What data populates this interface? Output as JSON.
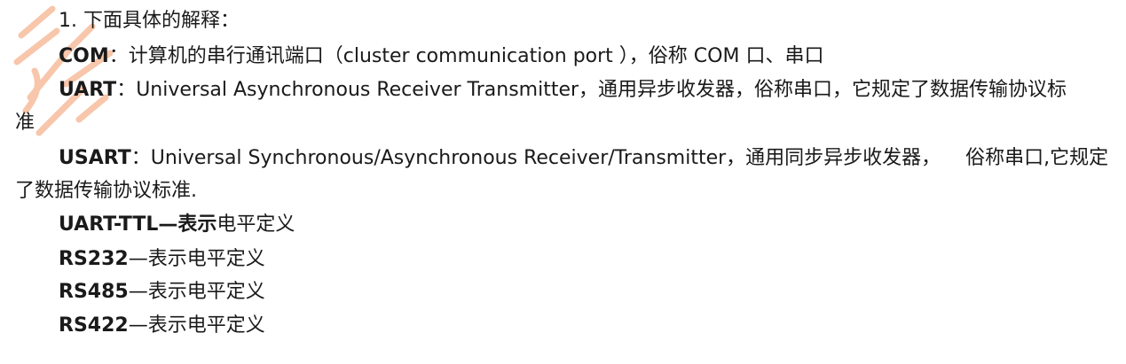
{
  "document": {
    "heading": "1. 下面具体的解释：",
    "com": {
      "term": "COM",
      "sep": "：",
      "text": "计算机的串行通讯端口（cluster communication port ），俗称 COM 口、串口"
    },
    "uart": {
      "term": "UART",
      "sep": "：",
      "text": "Universal Asynchronous Receiver Transmitter，通用异步收发器，俗称串口，它规定了数据传输协议标",
      "wrap": "准"
    },
    "usart": {
      "term": "USART",
      "sep": "：",
      "text_a": "Universal Synchronous/Asynchronous Receiver/Transmitter，通用同步异步收发器，",
      "text_b": "俗称串口,它规定",
      "wrap": "了数据传输协议标准."
    },
    "uart_ttl": {
      "term": "UART-TTL—表示",
      "text": "电平定义"
    },
    "rs232": {
      "term": "RS232",
      "text": "—表示电平定义"
    },
    "rs485": {
      "term": "RS485",
      "text": "—表示电平定义"
    },
    "rs422": {
      "term": "RS422",
      "text": "—表示电平定义"
    }
  },
  "colors": {
    "text": "#1a1a1a",
    "watermark": "#f4a77a"
  }
}
